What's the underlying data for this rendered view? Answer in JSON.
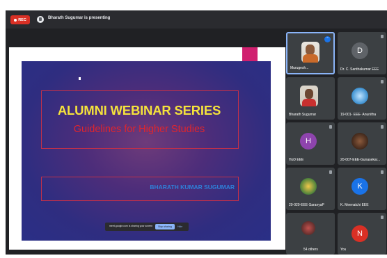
{
  "topbar": {
    "rec_label": "REC",
    "presenter_text": "Bharath Sugumar is presenting"
  },
  "slide": {
    "title": "ALUMNI WEBINAR SERIES",
    "subtitle": "Guidelines for Higher Studies",
    "speaker": "BHARATH KUMAR SUGUMAR"
  },
  "share_bar": {
    "text": "meet.google.com is sharing your screen",
    "stop_label": "Stop sharing",
    "hide_label": "Hide"
  },
  "participants": [
    {
      "name": "Murugesh...",
      "type": "video"
    },
    {
      "name": "Dr. C. Santhakumar EEE",
      "initial": "D",
      "color": "#5f6368"
    },
    {
      "name": "Bharath Sugumar",
      "type": "video"
    },
    {
      "name": "19-001- EEE- Anunitha",
      "type": "image"
    },
    {
      "name": "HoD EEE",
      "initial": "H",
      "color": "#8e44ad"
    },
    {
      "name": "20-007-EEE-Gunasekar...",
      "type": "image"
    },
    {
      "name": "20-020-EEE-SaranyaP",
      "type": "image"
    },
    {
      "name": "K. Meenatchi EEE",
      "initial": "K",
      "color": "#1a73e8"
    },
    {
      "name": "54 others",
      "type": "group"
    },
    {
      "name": "You",
      "initial": "N",
      "color": "#d93025"
    }
  ]
}
